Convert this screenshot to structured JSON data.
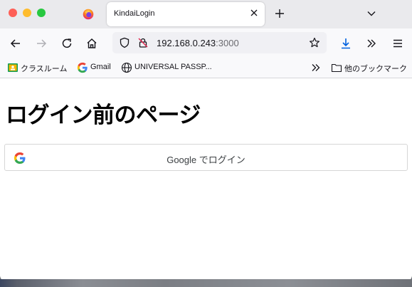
{
  "tab": {
    "title": "KindaiLogin"
  },
  "navbar": {
    "url_host": "192.168.0.243",
    "url_port": ":3000"
  },
  "bookmarks": {
    "items": [
      {
        "label": "クラスルーム",
        "icon": "classroom-icon"
      },
      {
        "label": "Gmail",
        "icon": "google-g-icon"
      },
      {
        "label": "UNIVERSAL PASSP...",
        "icon": "globe-icon"
      }
    ],
    "other_label": "他のブックマーク"
  },
  "page": {
    "title": "ログイン前のページ",
    "google_button_label": "Google でログイン"
  }
}
